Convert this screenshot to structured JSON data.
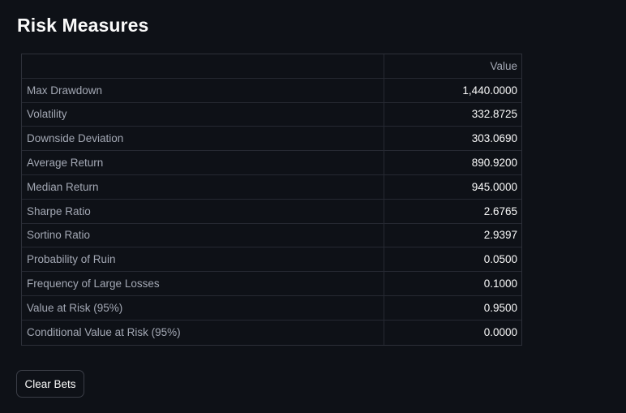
{
  "page": {
    "title": "Risk Measures"
  },
  "table": {
    "columns": [
      "",
      "Value"
    ],
    "rows": [
      {
        "label": "Max Drawdown",
        "value": "1,440.0000"
      },
      {
        "label": "Volatility",
        "value": "332.8725"
      },
      {
        "label": "Downside Deviation",
        "value": "303.0690"
      },
      {
        "label": "Average Return",
        "value": "890.9200"
      },
      {
        "label": "Median Return",
        "value": "945.0000"
      },
      {
        "label": "Sharpe Ratio",
        "value": "2.6765"
      },
      {
        "label": "Sortino Ratio",
        "value": "2.9397"
      },
      {
        "label": "Probability of Ruin",
        "value": "0.0500"
      },
      {
        "label": "Frequency of Large Losses",
        "value": "0.1000"
      },
      {
        "label": "Value at Risk (95%)",
        "value": "0.9500"
      },
      {
        "label": "Conditional Value at Risk (95%)",
        "value": "0.0000"
      }
    ]
  },
  "actions": {
    "clear_label": "Clear Bets"
  },
  "colors": {
    "background": "#0e1117",
    "text": "#fafafa",
    "muted_text": "#a3a8b4",
    "border": "#262932"
  }
}
